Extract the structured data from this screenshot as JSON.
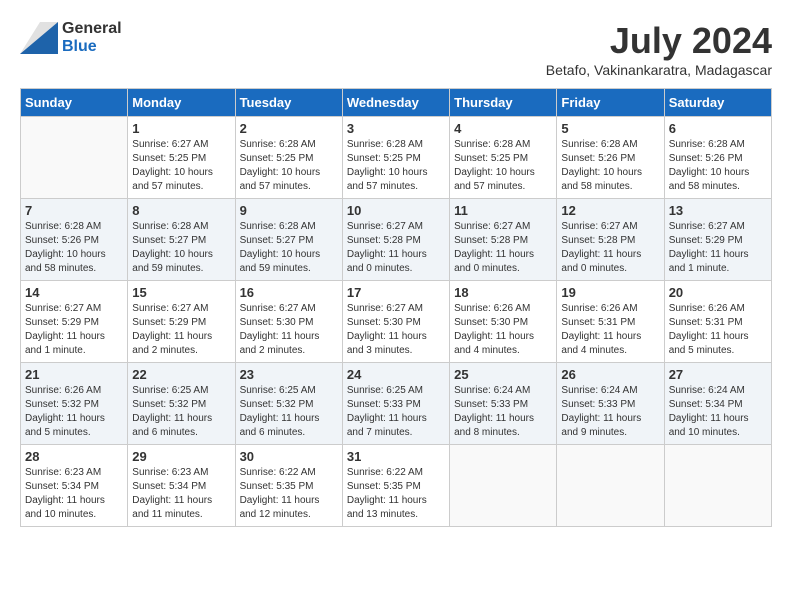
{
  "logo": {
    "general": "General",
    "blue": "Blue"
  },
  "title": "July 2024",
  "location": "Betafo, Vakinankaratra, Madagascar",
  "days_of_week": [
    "Sunday",
    "Monday",
    "Tuesday",
    "Wednesday",
    "Thursday",
    "Friday",
    "Saturday"
  ],
  "weeks": [
    [
      {
        "day": "",
        "info": ""
      },
      {
        "day": "1",
        "info": "Sunrise: 6:27 AM\nSunset: 5:25 PM\nDaylight: 10 hours\nand 57 minutes."
      },
      {
        "day": "2",
        "info": "Sunrise: 6:28 AM\nSunset: 5:25 PM\nDaylight: 10 hours\nand 57 minutes."
      },
      {
        "day": "3",
        "info": "Sunrise: 6:28 AM\nSunset: 5:25 PM\nDaylight: 10 hours\nand 57 minutes."
      },
      {
        "day": "4",
        "info": "Sunrise: 6:28 AM\nSunset: 5:25 PM\nDaylight: 10 hours\nand 57 minutes."
      },
      {
        "day": "5",
        "info": "Sunrise: 6:28 AM\nSunset: 5:26 PM\nDaylight: 10 hours\nand 58 minutes."
      },
      {
        "day": "6",
        "info": "Sunrise: 6:28 AM\nSunset: 5:26 PM\nDaylight: 10 hours\nand 58 minutes."
      }
    ],
    [
      {
        "day": "7",
        "info": "Sunrise: 6:28 AM\nSunset: 5:26 PM\nDaylight: 10 hours\nand 58 minutes."
      },
      {
        "day": "8",
        "info": "Sunrise: 6:28 AM\nSunset: 5:27 PM\nDaylight: 10 hours\nand 59 minutes."
      },
      {
        "day": "9",
        "info": "Sunrise: 6:28 AM\nSunset: 5:27 PM\nDaylight: 10 hours\nand 59 minutes."
      },
      {
        "day": "10",
        "info": "Sunrise: 6:27 AM\nSunset: 5:28 PM\nDaylight: 11 hours\nand 0 minutes."
      },
      {
        "day": "11",
        "info": "Sunrise: 6:27 AM\nSunset: 5:28 PM\nDaylight: 11 hours\nand 0 minutes."
      },
      {
        "day": "12",
        "info": "Sunrise: 6:27 AM\nSunset: 5:28 PM\nDaylight: 11 hours\nand 0 minutes."
      },
      {
        "day": "13",
        "info": "Sunrise: 6:27 AM\nSunset: 5:29 PM\nDaylight: 11 hours\nand 1 minute."
      }
    ],
    [
      {
        "day": "14",
        "info": "Sunrise: 6:27 AM\nSunset: 5:29 PM\nDaylight: 11 hours\nand 1 minute."
      },
      {
        "day": "15",
        "info": "Sunrise: 6:27 AM\nSunset: 5:29 PM\nDaylight: 11 hours\nand 2 minutes."
      },
      {
        "day": "16",
        "info": "Sunrise: 6:27 AM\nSunset: 5:30 PM\nDaylight: 11 hours\nand 2 minutes."
      },
      {
        "day": "17",
        "info": "Sunrise: 6:27 AM\nSunset: 5:30 PM\nDaylight: 11 hours\nand 3 minutes."
      },
      {
        "day": "18",
        "info": "Sunrise: 6:26 AM\nSunset: 5:30 PM\nDaylight: 11 hours\nand 4 minutes."
      },
      {
        "day": "19",
        "info": "Sunrise: 6:26 AM\nSunset: 5:31 PM\nDaylight: 11 hours\nand 4 minutes."
      },
      {
        "day": "20",
        "info": "Sunrise: 6:26 AM\nSunset: 5:31 PM\nDaylight: 11 hours\nand 5 minutes."
      }
    ],
    [
      {
        "day": "21",
        "info": "Sunrise: 6:26 AM\nSunset: 5:32 PM\nDaylight: 11 hours\nand 5 minutes."
      },
      {
        "day": "22",
        "info": "Sunrise: 6:25 AM\nSunset: 5:32 PM\nDaylight: 11 hours\nand 6 minutes."
      },
      {
        "day": "23",
        "info": "Sunrise: 6:25 AM\nSunset: 5:32 PM\nDaylight: 11 hours\nand 6 minutes."
      },
      {
        "day": "24",
        "info": "Sunrise: 6:25 AM\nSunset: 5:33 PM\nDaylight: 11 hours\nand 7 minutes."
      },
      {
        "day": "25",
        "info": "Sunrise: 6:24 AM\nSunset: 5:33 PM\nDaylight: 11 hours\nand 8 minutes."
      },
      {
        "day": "26",
        "info": "Sunrise: 6:24 AM\nSunset: 5:33 PM\nDaylight: 11 hours\nand 9 minutes."
      },
      {
        "day": "27",
        "info": "Sunrise: 6:24 AM\nSunset: 5:34 PM\nDaylight: 11 hours\nand 10 minutes."
      }
    ],
    [
      {
        "day": "28",
        "info": "Sunrise: 6:23 AM\nSunset: 5:34 PM\nDaylight: 11 hours\nand 10 minutes."
      },
      {
        "day": "29",
        "info": "Sunrise: 6:23 AM\nSunset: 5:34 PM\nDaylight: 11 hours\nand 11 minutes."
      },
      {
        "day": "30",
        "info": "Sunrise: 6:22 AM\nSunset: 5:35 PM\nDaylight: 11 hours\nand 12 minutes."
      },
      {
        "day": "31",
        "info": "Sunrise: 6:22 AM\nSunset: 5:35 PM\nDaylight: 11 hours\nand 13 minutes."
      },
      {
        "day": "",
        "info": ""
      },
      {
        "day": "",
        "info": ""
      },
      {
        "day": "",
        "info": ""
      }
    ]
  ]
}
